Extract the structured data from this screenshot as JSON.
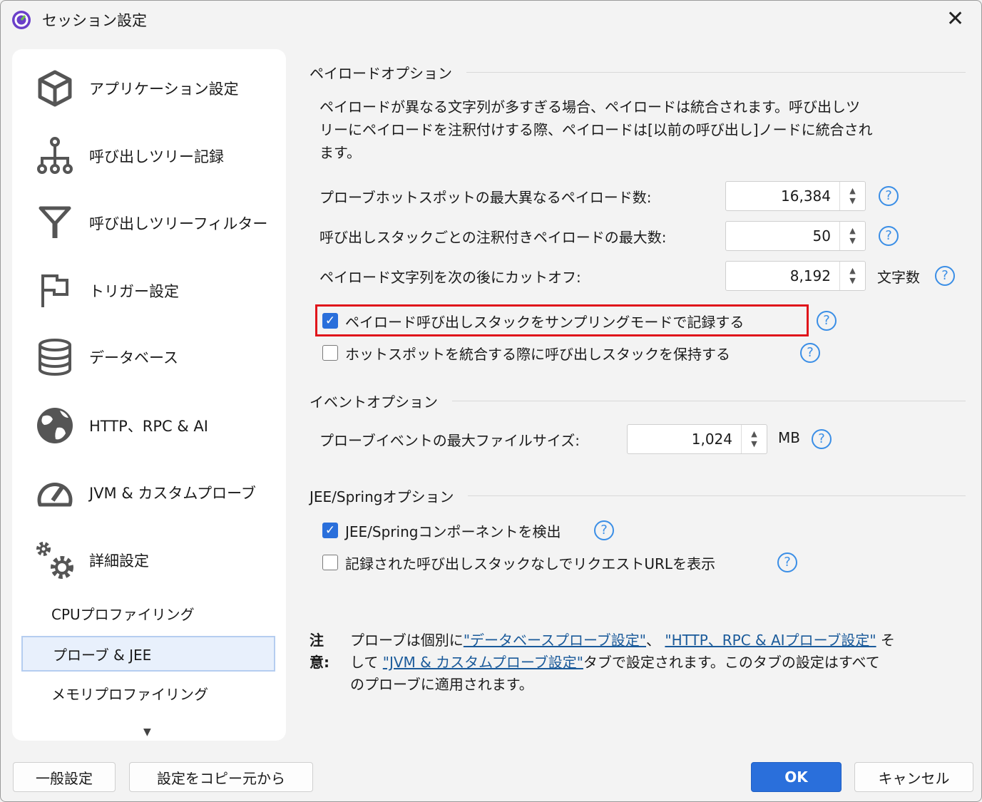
{
  "window": {
    "title": "セッション設定",
    "colors": {
      "accent": "#2a6fdb",
      "highlight": "#e0151b",
      "link": "#1a5a9a"
    }
  },
  "sidebar": {
    "items": [
      {
        "label": "アプリケーション設定",
        "icon": "cube-icon"
      },
      {
        "label": "呼び出しツリー記録",
        "icon": "tree-icon"
      },
      {
        "label": "呼び出しツリーフィルター",
        "icon": "filter-icon"
      },
      {
        "label": "トリガー設定",
        "icon": "flag-icon"
      },
      {
        "label": "データベース",
        "icon": "database-icon"
      },
      {
        "label": "HTTP、RPC & AI",
        "icon": "globe-icon"
      },
      {
        "label": "JVM & カスタムプローブ",
        "icon": "gauge-icon"
      },
      {
        "label": "詳細設定",
        "icon": "gears-icon"
      }
    ],
    "sub_items": [
      {
        "label": "CPUプロファイリング",
        "selected": false
      },
      {
        "label": "プローブ & JEE",
        "selected": true
      },
      {
        "label": "メモリプロファイリング",
        "selected": false
      }
    ]
  },
  "payload": {
    "header": "ペイロードオプション",
    "desc1": "ペイロードが異なる文字列が多すぎる場合、ペイロードは統合されます。呼び出しツ",
    "desc2": "リーにペイロードを注釈付けする際、ペイロードは[以前の呼び出し]ノードに統合され",
    "desc3": "ます。",
    "fields": [
      {
        "label": "プローブホットスポットの最大異なるペイロード数:",
        "value": "16,384",
        "unit": ""
      },
      {
        "label": "呼び出しスタックごとの注釈付きペイロードの最大数:",
        "value": "50",
        "unit": ""
      },
      {
        "label": "ペイロード文字列を次の後にカットオフ:",
        "value": "8,192",
        "unit": "文字数"
      }
    ],
    "checks": [
      {
        "label": "ペイロード呼び出しスタックをサンプリングモードで記録する",
        "checked": true
      },
      {
        "label": "ホットスポットを統合する際に呼び出しスタックを保持する",
        "checked": false
      }
    ]
  },
  "event": {
    "header": "イベントオプション",
    "label": "プローブイベントの最大ファイルサイズ:",
    "value": "1,024",
    "unit": "MB"
  },
  "jee": {
    "header": "JEE/Springオプション",
    "checks": [
      {
        "label": "JEE/Springコンポーネントを検出",
        "checked": true
      },
      {
        "label": "記録された呼び出しスタックなしでリクエストURLを表示",
        "checked": false
      }
    ]
  },
  "note": {
    "label1": "注",
    "label2": "意:",
    "t1": "プローブは個別に",
    "link1": "\"データベースプローブ設定\"",
    "t2": "、 ",
    "link2": "\"HTTP、RPC & AIプローブ設定\"",
    "t3": " そ",
    "t4": "して ",
    "link3": "\"JVM & カスタムプローブ設定\"",
    "t5": "タブで設定されます。このタブの設定はすべて",
    "t6": "のプローブに適用されます。"
  },
  "footer": {
    "general": "一般設定",
    "copy": "設定をコピー元から",
    "ok": "OK",
    "cancel": "キャンセル"
  },
  "help": "?"
}
